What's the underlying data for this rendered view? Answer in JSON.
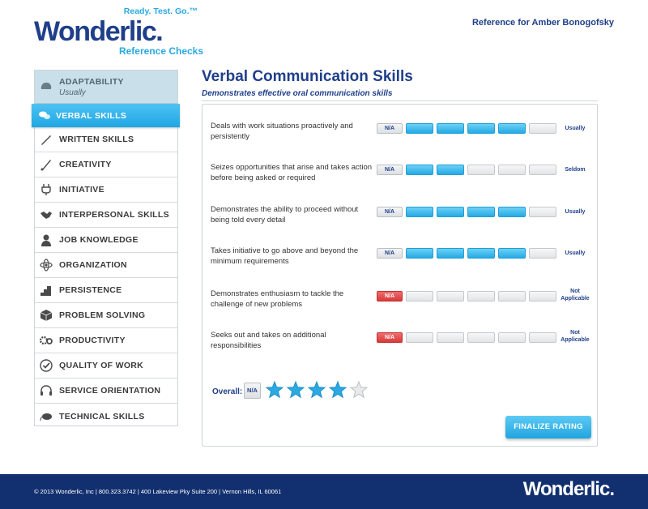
{
  "header": {
    "tagline": "Ready. Test. Go.™",
    "brand": "Wonderlic.",
    "subbrand": "Reference Checks",
    "reference_for": "Reference for Amber Bonogofsky"
  },
  "sidebar": {
    "items": [
      {
        "label": "ADAPTABILITY",
        "sub": "Usually",
        "icon": "brain-icon"
      },
      {
        "label": "VERBAL SKILLS",
        "icon": "speech-bubbles-icon"
      },
      {
        "label": "WRITTEN SKILLS",
        "icon": "pen-icon"
      },
      {
        "label": "CREATIVITY",
        "icon": "brush-icon"
      },
      {
        "label": "INITIATIVE",
        "icon": "plug-icon"
      },
      {
        "label": "INTERPERSONAL SKILLS",
        "icon": "handshake-icon"
      },
      {
        "label": "JOB KNOWLEDGE",
        "icon": "person-icon"
      },
      {
        "label": "ORGANIZATION",
        "icon": "atom-icon"
      },
      {
        "label": "PERSISTENCE",
        "icon": "steps-icon"
      },
      {
        "label": "PROBLEM SOLVING",
        "icon": "cube-icon"
      },
      {
        "label": "PRODUCTIVITY",
        "icon": "gears-icon"
      },
      {
        "label": "QUALITY OF WORK",
        "icon": "check-badge-icon"
      },
      {
        "label": "SERVICE ORIENTATION",
        "icon": "headset-icon"
      },
      {
        "label": "TECHNICAL SKILLS",
        "icon": "mouse-icon"
      }
    ]
  },
  "main": {
    "title": "Verbal Communication Skills",
    "subtitle": "Demonstrates effective oral communication skills",
    "na_label": "N/A",
    "questions": [
      {
        "text": "Deals with work situations proactively and persistently",
        "filled": 4,
        "na": false,
        "rating": "Usually"
      },
      {
        "text": "Seizes opportunities that arise and takes action before being asked or required",
        "filled": 2,
        "na": false,
        "rating": "Seldom"
      },
      {
        "text": "Demonstrates the ability to proceed without being told every detail",
        "filled": 4,
        "na": false,
        "rating": "Usually"
      },
      {
        "text": "Takes initiative to go above and beyond the minimum requirements",
        "filled": 4,
        "na": false,
        "rating": "Usually"
      },
      {
        "text": "Demonstrates enthusiasm to tackle the challenge of new problems",
        "filled": 0,
        "na": true,
        "rating": "Not Applicable"
      },
      {
        "text": "Seeks out and takes on additional responsibilities",
        "filled": 0,
        "na": true,
        "rating": "Not Applicable"
      }
    ],
    "overall": {
      "label": "Overall:",
      "na_label": "N/A",
      "stars": 4,
      "max_stars": 5
    },
    "finalize_label": "FINALIZE RATING"
  },
  "colors": {
    "navy": "#1f3f8a",
    "accent_blue": "#29a9e0",
    "na_red": "#d83b3b",
    "footer": "#12306f"
  },
  "footer": {
    "text": "© 2013 Wonderlic, Inc | 800.323.3742 | 400 Lakeview Pky Suite 200 | Vernon Hills, IL 60061",
    "logo": "Wonderlic."
  }
}
